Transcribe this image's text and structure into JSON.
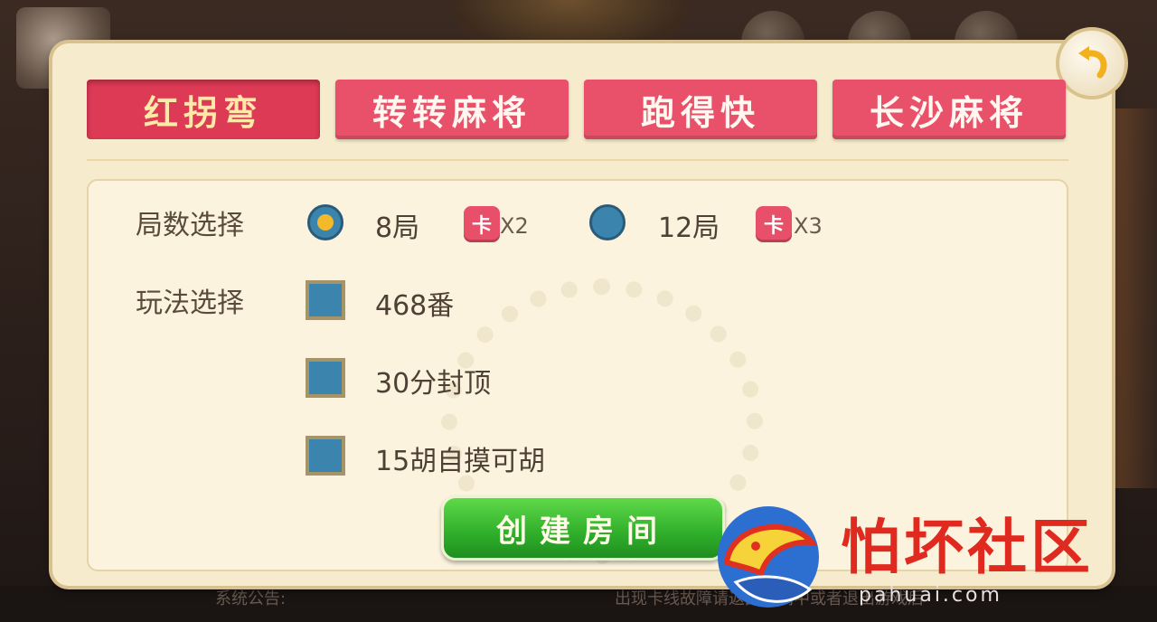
{
  "tabs": [
    {
      "label": "红拐弯",
      "active": true
    },
    {
      "label": "转转麻将",
      "active": false
    },
    {
      "label": "跑得快",
      "active": false
    },
    {
      "label": "长沙麻将",
      "active": false
    }
  ],
  "rounds": {
    "label": "局数选择",
    "options": [
      {
        "label": "8局",
        "card": "卡",
        "mult": "X2",
        "selected": true
      },
      {
        "label": "12局",
        "card": "卡",
        "mult": "X3",
        "selected": false
      }
    ]
  },
  "play": {
    "label": "玩法选择",
    "options": [
      {
        "label": "468番"
      },
      {
        "label": "30分封顶"
      },
      {
        "label": "15胡自摸可胡"
      }
    ]
  },
  "create_button": "创建房间",
  "background": {
    "announcement": "系统公告:",
    "notice": "出现卡线故障请返回房间中或者退出游戏后"
  },
  "watermark": {
    "brand": "怕坏社区",
    "url": "pahuai.com"
  },
  "colors": {
    "tab": "#e9506a",
    "radio": "#3b84ae",
    "selected_dot": "#f3b92b",
    "create": "#2fae2a"
  },
  "icons": {
    "back": "back-arrow-icon",
    "card": "card-icon"
  }
}
